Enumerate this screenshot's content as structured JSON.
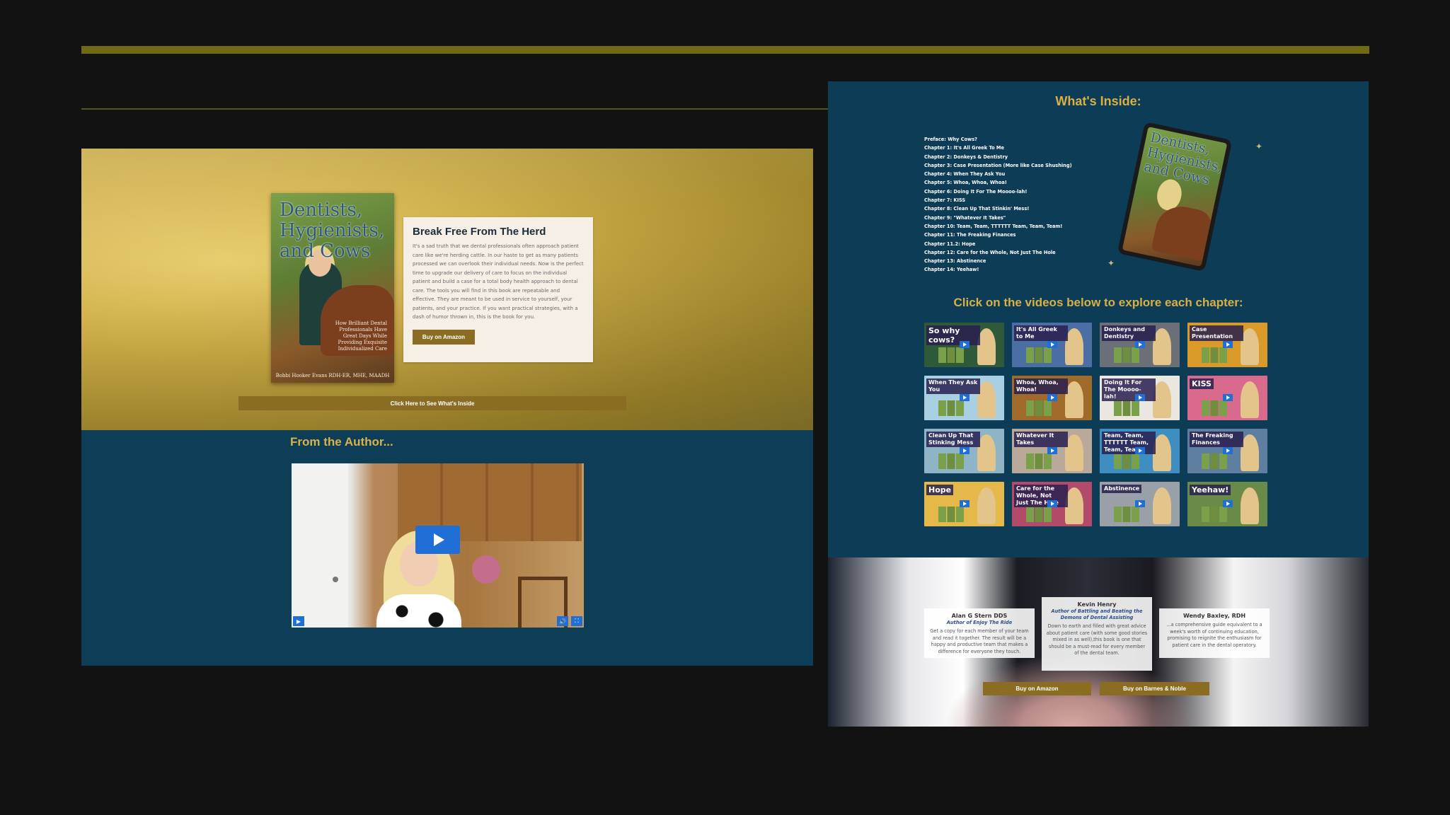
{
  "colors": {
    "accent_gold": "#d9b044",
    "button_gold": "#8a6d22",
    "navy": "#0c3c56",
    "video_blue": "#1f6fd6"
  },
  "left": {
    "book": {
      "title": "Dentists, Hygienists, and Cows",
      "tagline": "How Brilliant Dental Professionals Have Great Days While Providing Exquisite Individualized Care",
      "author": "Bobbi Hooker Evans RDH-ER, MHE, MAADH"
    },
    "card": {
      "heading": "Break Free From The Herd",
      "body": "It's a sad truth that we dental professionals often approach patient care like we're herding cattle. In our haste to get as many patients processed we can overlook their individual needs. Now is the perfect time to upgrade our delivery of care to focus on the individual patient and build a case for a total body health approach to dental care. The tools you will find in this book are repeatable and effective. They are meant to be used in service to yourself, your patients, and your practice. If you want practical strategies, with a dash of humor thrown in, this is the book for you.",
      "button": "Buy on Amazon"
    },
    "whats_inside_button": "Click Here to See What's Inside",
    "from_author": "From the Author...",
    "video": {
      "play_icon": "play-icon",
      "controls": [
        "play-small-icon",
        "volume-icon",
        "fullscreen-icon"
      ]
    }
  },
  "right": {
    "title": "What's Inside:",
    "chapters": [
      "Preface: Why Cows?",
      "Chapter 1: It's All Greek To Me",
      "Chapter 2: Donkeys & Dentistry",
      "Chapter 3: Case Presentation (More like Case Shushing)",
      "Chapter 4: When They Ask You",
      "Chapter 5: Whoa, Whoa, Whoa!",
      "Chapter 6: Doing It For The Moooo-lah!",
      "Chapter 7: KISS",
      "Chapter 8: Clean Up That Stinkin' Mess!",
      "Chapter 9: \"Whatever It Takes\"",
      "Chapter 10: Team, Team, TTTTTT Team, Team, Team!",
      "Chapter 11: The Freaking Finances",
      "Chapter 11.2: Hope",
      "Chapter 12: Care for the Whole, Not Just The Hole",
      "Chapter 13: Abstinence",
      "Chapter 14: Yeehaw!"
    ],
    "tablet_title": "Dentists, Hygienists, and Cows",
    "explore": "Click on the videos below to explore each chapter:",
    "thumbnails": [
      {
        "label": "So why cows?",
        "bg": "#2f5a3a",
        "big": true
      },
      {
        "label": "It's All Greek to Me",
        "bg": "#4b6fa4",
        "big": false
      },
      {
        "label": "Donkeys and Dentistry",
        "bg": "#6b6f78",
        "big": false
      },
      {
        "label": "Case Presentation",
        "bg": "#d99a2a",
        "big": false
      },
      {
        "label": "When They Ask You",
        "bg": "#a8cfe2",
        "big": false
      },
      {
        "label": "Whoa, Whoa, Whoa!",
        "bg": "#a06a2a",
        "big": false
      },
      {
        "label": "Doing It For The Moooo-lah!",
        "bg": "#e9e7e0",
        "big": false
      },
      {
        "label": "KISS",
        "bg": "#d86a8e",
        "big": true
      },
      {
        "label": "Clean Up That Stinking Mess",
        "bg": "#8fb4c6",
        "big": false
      },
      {
        "label": "Whatever It Takes",
        "bg": "#b8a99a",
        "big": false
      },
      {
        "label": "Team, Team, TTTTTT Team, Team, Team!",
        "bg": "#3f8ec2",
        "big": false
      },
      {
        "label": "The Freaking Finances",
        "bg": "#5f7fa0",
        "big": false
      },
      {
        "label": "Hope",
        "bg": "#e5b84a",
        "big": true
      },
      {
        "label": "Care for the Whole, Not Just The Hole",
        "bg": "#b24a6a",
        "big": false
      },
      {
        "label": "Abstinence",
        "bg": "#9aa0a8",
        "big": false
      },
      {
        "label": "Yeehaw!",
        "bg": "#6a8a4a",
        "big": true
      }
    ],
    "testimonials": [
      {
        "name": "Alan G Stern DDS",
        "sub": "Author of Enjoy The Ride",
        "quote": "Get a copy for each member of your team and read it together. The result will be a happy and productive team that makes a difference for everyone they touch."
      },
      {
        "name": "Kevin Henry",
        "sub": "Author of Battling and Beating the Demons of Dental Assisting",
        "quote": "Down to earth and filled with great advice about patient care (with some good stories mixed in as well),this book is one that should be a must-read for every member of the dental team."
      },
      {
        "name": "Wendy Baxley, RDH",
        "sub": "",
        "quote": "...a comprehensive guide equivalent to a week's worth of continuing education, promising to reignite the enthusiasm for patient care in the dental operatory."
      }
    ],
    "buy_amazon": "Buy on Amazon",
    "buy_bn": "Buy on Barnes & Noble"
  }
}
